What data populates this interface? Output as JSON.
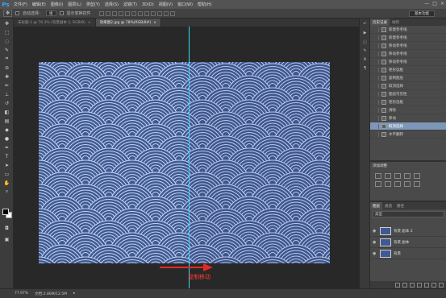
{
  "app": {
    "logo": "Ps"
  },
  "menu": [
    "文件(F)",
    "编辑(E)",
    "图像(I)",
    "图层(L)",
    "类型(Y)",
    "选择(S)",
    "滤镜(T)",
    "3D(D)",
    "视图(V)",
    "窗口(W)",
    "帮助(H)"
  ],
  "window_controls": [
    "—",
    "□",
    "×"
  ],
  "options": {
    "auto_select_label": "自动选择：",
    "auto_select_value": "组",
    "transform_label": "显示变换控件",
    "workspace": "基本功能"
  },
  "tabs": [
    {
      "label": "未标题-1 @ 76.3% (背景副本 2, RGB/8)",
      "close": "×"
    },
    {
      "label": "效果图2.jpg @ 78%(RGB/8#)",
      "close": "×"
    }
  ],
  "annotation": "复制移动",
  "status": {
    "zoom": "77.97%",
    "doc": "文档:2.86M/12.5M"
  },
  "panel_tabs": {
    "history": [
      "历史记录",
      "动作"
    ],
    "layers": [
      "图层",
      "通道",
      "路径"
    ]
  },
  "history": [
    {
      "label": "新建参考线",
      "selected": false
    },
    {
      "label": "新建参考线",
      "selected": false
    },
    {
      "label": "移动参考线",
      "selected": false
    },
    {
      "label": "移动参考线",
      "selected": false
    },
    {
      "label": "移动参考线",
      "selected": false
    },
    {
      "label": "矩形选框",
      "selected": false
    },
    {
      "label": "复制图层",
      "selected": false
    },
    {
      "label": "取消选择",
      "selected": false
    },
    {
      "label": "图层可见性",
      "selected": false
    },
    {
      "label": "矩形选框",
      "selected": false
    },
    {
      "label": "清除",
      "selected": false
    },
    {
      "label": "移动",
      "selected": false
    },
    {
      "label": "取消选择",
      "selected": true
    },
    {
      "label": "水平翻转",
      "selected": false
    }
  ],
  "adjustments": {
    "title": "添加调整"
  },
  "layers": {
    "filter": "类型",
    "items": [
      {
        "name": "背景 副本 2",
        "visible": true
      },
      {
        "name": "背景 副本",
        "visible": true
      },
      {
        "name": "背景",
        "visible": true
      }
    ]
  },
  "colors": {
    "accent": "#3fd6ff",
    "annotation": "#ff3b2e",
    "image": "#3f5a93",
    "selected": "#7d97b8"
  }
}
